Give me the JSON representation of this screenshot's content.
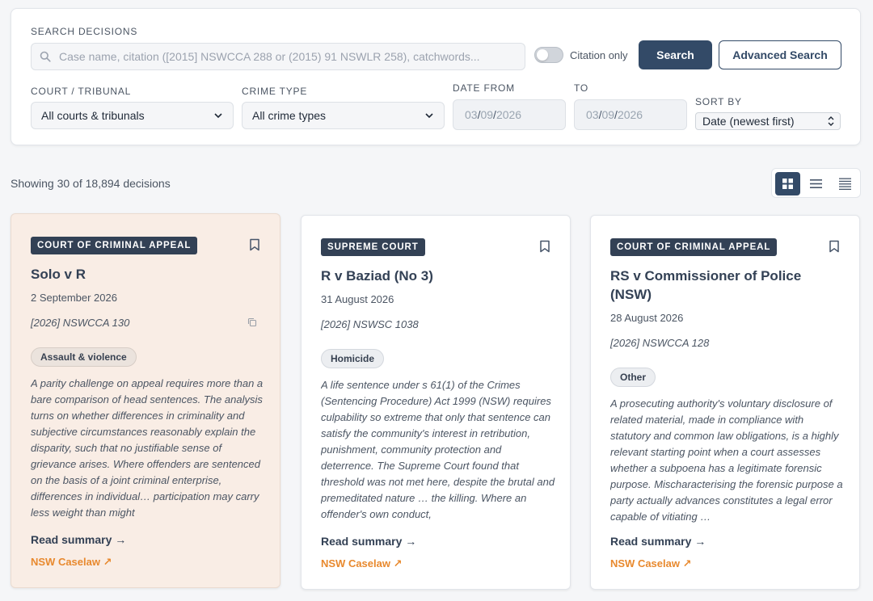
{
  "search": {
    "label": "SEARCH DECISIONS",
    "placeholder": "Case name, citation ([2015] NSWCCA 288 or (2015) 91 NSWLR 258), catchwords...",
    "value": "",
    "citation_only_label": "Citation only",
    "citation_only_on": false,
    "search_button": "Search",
    "advanced_button": "Advanced Search"
  },
  "filters": {
    "court_label": "COURT / TRIBUNAL",
    "court_value": "All courts & tribunals",
    "crime_label": "CRIME TYPE",
    "crime_value": "All crime types",
    "date_from_label": "DATE FROM",
    "date_to_label": "TO",
    "date_from": {
      "mm": "03",
      "dd": "09",
      "yyyy": "2026"
    },
    "date_to": {
      "mm": "03",
      "dd": "09",
      "yyyy": "2026"
    },
    "sort_label": "SORT BY",
    "sort_value": "Date (newest first)"
  },
  "results": {
    "showing": "Showing 30 of 18,894 decisions",
    "view_modes": [
      "grid-view",
      "list-view",
      "compact-view"
    ],
    "active_view": "grid-view"
  },
  "cards": [
    {
      "court": "COURT OF CRIMINAL APPEAL",
      "title": "Solo v R",
      "date": "2 September 2026",
      "citation": "[2026] NSWCCA 130",
      "tag": "Assault & violence",
      "summary": "A parity challenge on appeal requires more than a bare comparison of head sentences. The analysis turns on whether differences in criminality and subjective circumstances reasonably explain the disparity, such that no justifiable sense of grievance arises. Where offenders are sentenced on the basis of a joint criminal enterprise, differences in individual… participation may carry less weight than might",
      "read_summary": "Read summary →",
      "caselaw": "NSW Caselaw ↗",
      "highlighted": true
    },
    {
      "court": "SUPREME COURT",
      "title": "R v Baziad (No 3)",
      "date": "31 August 2026",
      "citation": "[2026] NSWSC 1038",
      "tag": "Homicide",
      "summary": "A life sentence under s 61(1) of the Crimes (Sentencing Procedure) Act 1999 (NSW) requires culpability so extreme that only that sentence can satisfy the community's interest in retribution, punishment, community protection and deterrence. The Supreme Court found that threshold was not met here, despite the brutal and premeditated nature … the killing. Where an offender's own conduct,",
      "read_summary": "Read summary →",
      "caselaw": "NSW Caselaw ↗",
      "highlighted": false
    },
    {
      "court": "COURT OF CRIMINAL APPEAL",
      "title": "RS v Commissioner of Police (NSW)",
      "date": "28 August 2026",
      "citation": "[2026] NSWCCA 128",
      "tag": "Other",
      "summary": "A prosecuting authority's voluntary disclosure of related material, made in compliance with statutory and common law obligations, is a highly relevant starting point when a court assesses whether a subpoena has a legitimate forensic purpose. Mischaracterising the forensic purpose a party actually advances constitutes a legal error capable of vitiating …",
      "read_summary": "Read summary →",
      "caselaw": "NSW Caselaw ↗",
      "highlighted": false
    }
  ]
}
